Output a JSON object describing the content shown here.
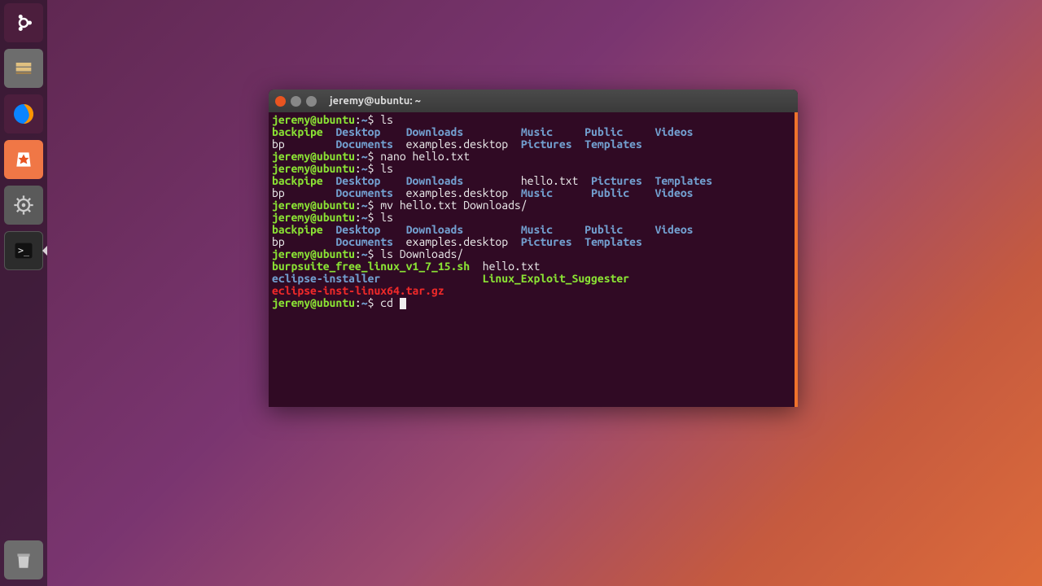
{
  "window": {
    "title": "jeremy@ubuntu: ~"
  },
  "prompt": {
    "user_host": "jeremy@ubuntu",
    "path": "~",
    "sep": ":",
    "dollar": "$"
  },
  "launcher": {
    "items": [
      "ubuntu-dash",
      "files",
      "firefox",
      "software",
      "settings",
      "terminal"
    ],
    "trash": "trash"
  },
  "session": {
    "cmd1": "ls",
    "ls1_row1": [
      "backpipe",
      "Desktop",
      "Downloads",
      "Music",
      "Public",
      "Videos"
    ],
    "ls1_row2": [
      "bp",
      "Documents",
      "examples.desktop",
      "Pictures",
      "Templates"
    ],
    "cmd2": "nano hello.txt",
    "cmd3": "ls",
    "ls2_row1": [
      "backpipe",
      "Desktop",
      "Downloads",
      "hello.txt",
      "Pictures",
      "Templates"
    ],
    "ls2_row2": [
      "bp",
      "Documents",
      "examples.desktop",
      "Music",
      "Public",
      "Videos"
    ],
    "cmd4": "mv hello.txt Downloads/",
    "cmd5": "ls",
    "ls3_row1": [
      "backpipe",
      "Desktop",
      "Downloads",
      "Music",
      "Public",
      "Videos"
    ],
    "ls3_row2": [
      "bp",
      "Documents",
      "examples.desktop",
      "Pictures",
      "Templates"
    ],
    "cmd6": "ls Downloads/",
    "dl_row1": [
      "burpsuite_free_linux_v1_7_15.sh",
      "hello.txt"
    ],
    "dl_row2": [
      "eclipse-installer",
      "Linux_Exploit_Suggester"
    ],
    "dl_row3": [
      "eclipse-inst-linux64.tar.gz"
    ],
    "cmd7": "cd "
  },
  "colors": {
    "term_bg": "#300a24",
    "prompt_green": "#8ae234",
    "prompt_blue": "#729fcf",
    "dir_blue": "#729fcf",
    "exec_green": "#8ae234",
    "archive_red": "#ef2929"
  }
}
